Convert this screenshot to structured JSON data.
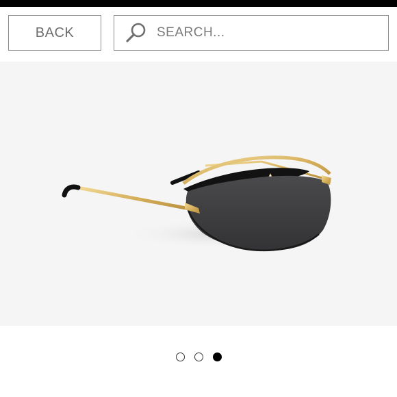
{
  "header": {
    "back_label": "BACK",
    "search": {
      "placeholder": "SEARCH...",
      "icon": "search-icon"
    }
  },
  "product": {
    "image": "sunglasses"
  },
  "carousel": {
    "count": 3,
    "active_index": 2
  },
  "colors": {
    "top_bar": "#000000",
    "border": "#8c8c8c",
    "text": "#6e6e6e",
    "product_bg": "#f5f5f5",
    "gold": "#d9b866",
    "lens": "#3d3d3f",
    "dot_active": "#000000"
  }
}
